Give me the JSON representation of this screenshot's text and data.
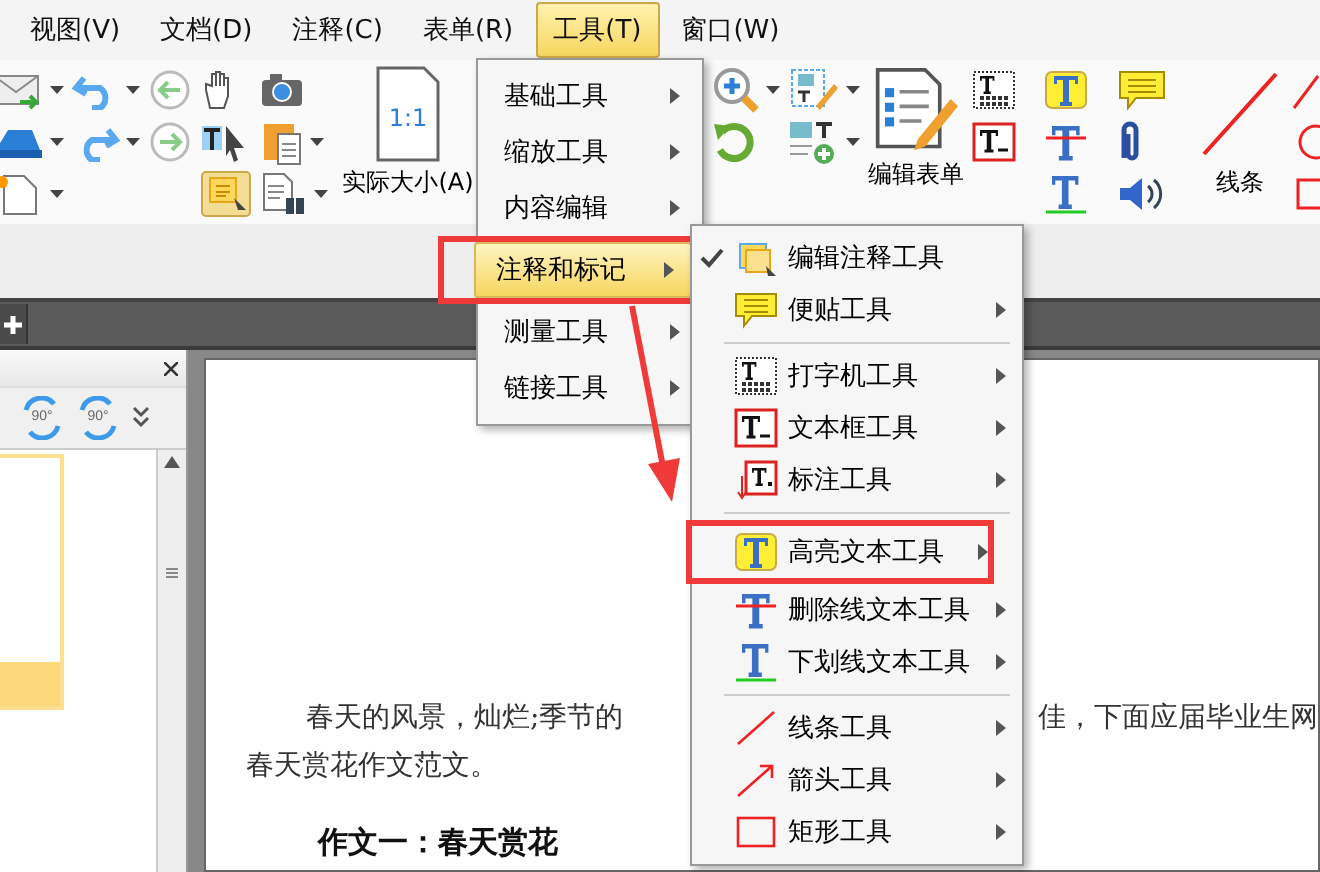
{
  "menubar": {
    "items": [
      {
        "label": "视图(V)",
        "selected": false
      },
      {
        "label": "文档(D)",
        "selected": false
      },
      {
        "label": "注释(C)",
        "selected": false
      },
      {
        "label": "表单(R)",
        "selected": false
      },
      {
        "label": "工具(T)",
        "selected": true
      },
      {
        "label": "窗口(W)",
        "selected": false
      }
    ]
  },
  "toolbar": {
    "actual_size_icon_text": "1:1",
    "actual_size": "实际大小(A)",
    "edit_form": "编辑表单",
    "line": "线条"
  },
  "side_panel": {
    "rotate_buttons": [
      "90°",
      "90°"
    ]
  },
  "document": {
    "line_1_start": "春天的风景，灿烂;季节的",
    "line_1_end": "佳，下面应届毕业生网",
    "line_2": "春天赏花作文范文。",
    "heading": "作文一：春天赏花"
  },
  "tools_menu": {
    "items": [
      {
        "label": "基础工具",
        "selected": false,
        "marked": false
      },
      {
        "label": "缩放工具",
        "selected": false,
        "marked": false
      },
      {
        "label": "内容编辑",
        "selected": false,
        "marked": false
      },
      {
        "label": "注释和标记",
        "selected": true,
        "marked": true
      },
      {
        "label": "测量工具",
        "selected": false,
        "marked": false
      },
      {
        "label": "链接工具",
        "selected": false,
        "marked": false
      }
    ]
  },
  "submenu": {
    "groups": [
      [
        {
          "label": "编辑注释工具",
          "checked": true,
          "has_submenu": false,
          "marked": false
        },
        {
          "label": "便贴工具",
          "checked": false,
          "has_submenu": true,
          "marked": false
        }
      ],
      [
        {
          "label": "打字机工具",
          "checked": false,
          "has_submenu": true,
          "marked": false
        },
        {
          "label": "文本框工具",
          "checked": false,
          "has_submenu": true,
          "marked": false
        },
        {
          "label": "标注工具",
          "checked": false,
          "has_submenu": true,
          "marked": false
        }
      ],
      [
        {
          "label": "高亮文本工具",
          "checked": false,
          "has_submenu": true,
          "marked": true
        },
        {
          "label": "删除线文本工具",
          "checked": false,
          "has_submenu": true,
          "marked": false
        },
        {
          "label": "下划线文本工具",
          "checked": false,
          "has_submenu": true,
          "marked": false
        }
      ],
      [
        {
          "label": "线条工具",
          "checked": false,
          "has_submenu": true,
          "marked": false
        },
        {
          "label": "箭头工具",
          "checked": false,
          "has_submenu": true,
          "marked": false
        },
        {
          "label": "矩形工具",
          "checked": false,
          "has_submenu": true,
          "marked": false
        }
      ]
    ]
  }
}
